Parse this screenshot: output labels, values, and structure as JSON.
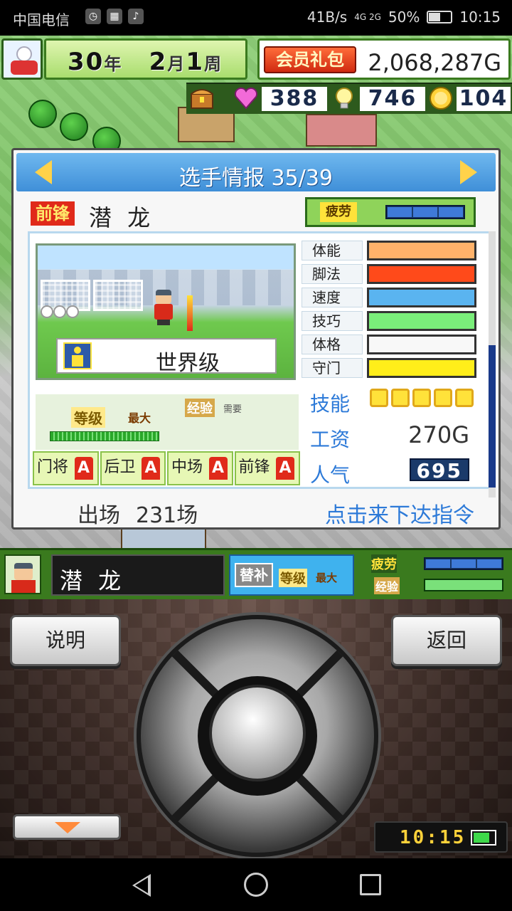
{
  "status_bar": {
    "carrier": "中国电信",
    "net_speed": "41B/s",
    "signal": "4G 2G",
    "battery": "50%",
    "time": "10:15"
  },
  "top_hud": {
    "year_num": "30",
    "year_unit": "年",
    "month_num": "2",
    "month_unit": "月",
    "week_num": "1",
    "week_unit": "周",
    "vip_pack": "会员礼包",
    "gold": "2,068,287G"
  },
  "resources": {
    "hearts": "388",
    "ideas": "746",
    "medals": "104"
  },
  "dialog": {
    "title": "选手情报 35/39",
    "position": "前锋",
    "player_name": "潜 龙",
    "fatigue_label": "疲劳",
    "rank": "世界级",
    "stats": [
      {
        "label": "体能",
        "color": "#ffb26a"
      },
      {
        "label": "脚法",
        "color": "#ff4a1a"
      },
      {
        "label": "速度",
        "color": "#5ab4f0"
      },
      {
        "label": "技巧",
        "color": "#7aee7a"
      },
      {
        "label": "体格",
        "color": "#f8f8f8"
      },
      {
        "label": "守门",
        "color": "#ffee1a"
      }
    ],
    "level_label": "等级",
    "level_max": "最大",
    "exp_label": "经验",
    "exp_need": "需要",
    "positions": [
      {
        "label": "门将",
        "grade": "A"
      },
      {
        "label": "后卫",
        "grade": "A"
      },
      {
        "label": "中场",
        "grade": "A"
      },
      {
        "label": "前锋",
        "grade": "A"
      }
    ],
    "skill_label": "技能",
    "salary_label": "工资",
    "salary": "270G",
    "popularity_label": "人气",
    "popularity": "695",
    "appearances_label": "出场",
    "appearances": "231场",
    "command_link": "点击来下达指令"
  },
  "player_bar": {
    "name": "潜 龙",
    "sub_badge": "替补",
    "level_label": "等级",
    "level_max": "最大",
    "fatigue_label": "疲劳",
    "exp_label": "经验"
  },
  "controls": {
    "help_button": "说明",
    "back_button": "返回",
    "clock": "10:15"
  }
}
